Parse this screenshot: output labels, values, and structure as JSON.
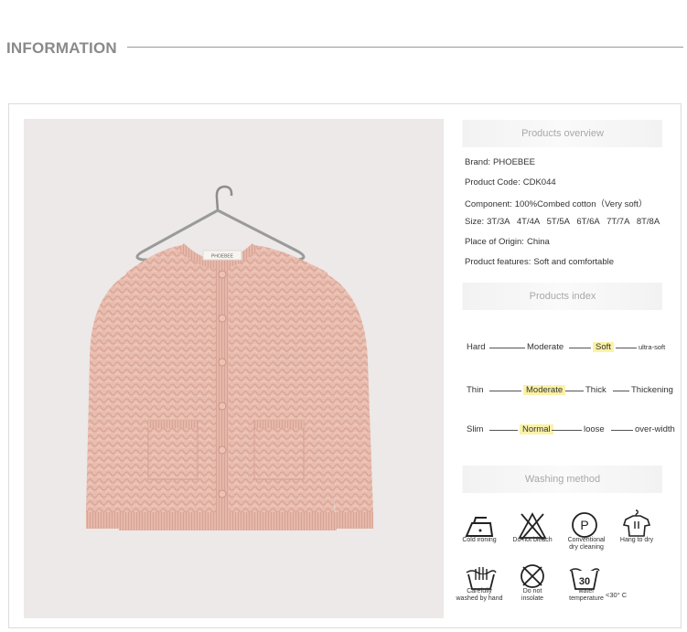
{
  "header": {
    "title": "INFORMATION"
  },
  "overview": {
    "title": "Products overview",
    "specs": [
      {
        "key": "Brand:",
        "value": "PHOEBEE"
      },
      {
        "key": "Product Code:",
        "value": "CDK044"
      },
      {
        "key": "Component:",
        "value": "100%Combed cotton（Very soft）"
      },
      {
        "key": "Size:",
        "value": "3T/3A   4T/4A   5T/5A   6T/6A   7T/7A   8T/8A"
      },
      {
        "key": "Place of Origin:",
        "value": "China"
      },
      {
        "key": "Product features:",
        "value": "Soft and comfortable"
      }
    ]
  },
  "index": {
    "title": "Products index",
    "rows": [
      {
        "labels": [
          "Hard",
          "Moderate",
          "Soft",
          "ultra-soft"
        ],
        "selected": 2
      },
      {
        "labels": [
          "Thin",
          "Moderate",
          "Thick",
          "Thickening"
        ],
        "selected": 1
      },
      {
        "labels": [
          "Slim",
          "Normal",
          "loose",
          "over-width"
        ],
        "selected": 1
      }
    ]
  },
  "washing": {
    "title": "Washing method",
    "items": [
      {
        "icon": "iron-icon",
        "label": "Cold ironing"
      },
      {
        "icon": "no-bleach-icon",
        "label": "Do not bleach"
      },
      {
        "icon": "dry-clean-icon",
        "label": "Conventional\ndry cleaning",
        "symbol": "P"
      },
      {
        "icon": "hang-dry-icon",
        "label": "Hang to dry"
      },
      {
        "icon": "hand-wash-icon",
        "label": "Carefully\nwashed by hand"
      },
      {
        "icon": "no-insolate-icon",
        "label": "Do not\ninsolate"
      },
      {
        "icon": "water-temp-icon",
        "label": "water\ntemperature",
        "symbol": "30",
        "extra": "<30° C"
      }
    ]
  },
  "product_image": {
    "brand_tag": "PHOEBEE"
  },
  "colors": {
    "photo_bg": "#ece9e8",
    "cardigan": "#e8bcae",
    "highlight": "#fbf2a6"
  }
}
